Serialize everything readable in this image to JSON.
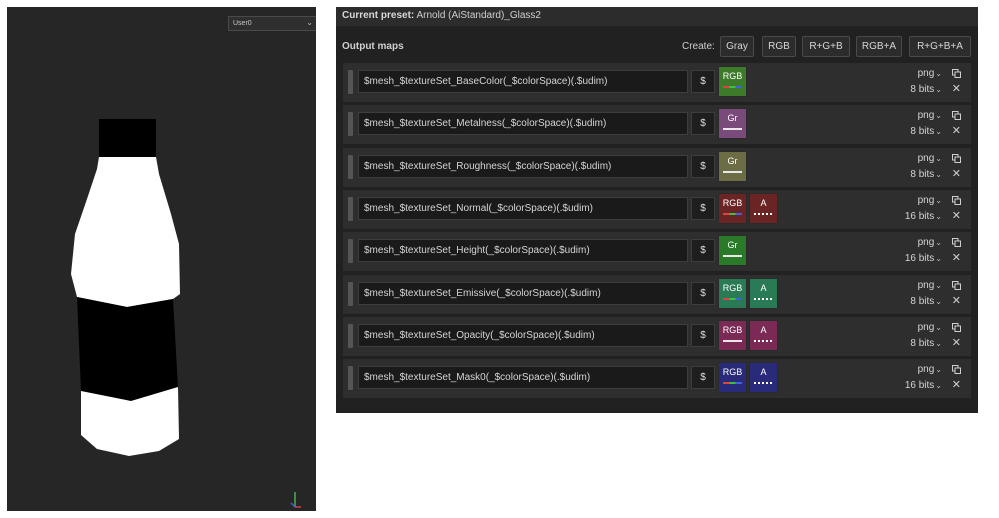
{
  "viewport": {
    "camera": "User0"
  },
  "preset": {
    "label": "Current preset:",
    "value": "Arnold (AiStandard)_Glass2"
  },
  "output_maps": {
    "title": "Output maps",
    "create_label": "Create:",
    "create_buttons": [
      "Gray",
      "RGB",
      "R+G+B",
      "RGB+A",
      "R+G+B+A"
    ]
  },
  "rows": [
    {
      "path": "$mesh_$textureSet_BaseColor(_$colorSpace)(.$udim)",
      "dollar": "$",
      "format": "png",
      "bits": "8 bits",
      "channels": [
        {
          "label": "RGB",
          "color": "#3d7a2a",
          "bar": "rgb"
        }
      ]
    },
    {
      "path": "$mesh_$textureSet_Metalness(_$colorSpace)(.$udim)",
      "dollar": "$",
      "format": "png",
      "bits": "8 bits",
      "channels": [
        {
          "label": "Gr",
          "color": "#7a4a7a",
          "bar": "solid"
        }
      ]
    },
    {
      "path": "$mesh_$textureSet_Roughness(_$colorSpace)(.$udim)",
      "dollar": "$",
      "format": "png",
      "bits": "8 bits",
      "channels": [
        {
          "label": "Gr",
          "color": "#6d6d45",
          "bar": "solid"
        }
      ]
    },
    {
      "path": "$mesh_$textureSet_Normal(_$colorSpace)(.$udim)",
      "dollar": "$",
      "format": "png",
      "bits": "16 bits",
      "channels": [
        {
          "label": "RGB",
          "color": "#6b2424",
          "bar": "rgb"
        },
        {
          "label": "A",
          "color": "#6b2424",
          "bar": "dotted"
        }
      ]
    },
    {
      "path": "$mesh_$textureSet_Height(_$colorSpace)(.$udim)",
      "dollar": "$",
      "format": "png",
      "bits": "16 bits",
      "channels": [
        {
          "label": "Gr",
          "color": "#2a7a2a",
          "bar": "solid"
        }
      ]
    },
    {
      "path": "$mesh_$textureSet_Emissive(_$colorSpace)(.$udim)",
      "dollar": "$",
      "format": "png",
      "bits": "8 bits",
      "channels": [
        {
          "label": "RGB",
          "color": "#2a7a55",
          "bar": "rgb"
        },
        {
          "label": "A",
          "color": "#2a7a55",
          "bar": "dotted"
        }
      ]
    },
    {
      "path": "$mesh_$textureSet_Opacity(_$colorSpace)(.$udim)",
      "dollar": "$",
      "format": "png",
      "bits": "8 bits",
      "channels": [
        {
          "label": "RGB",
          "color": "#7a2a55",
          "bar": "solid"
        },
        {
          "label": "A",
          "color": "#7a2a55",
          "bar": "dotted"
        }
      ]
    },
    {
      "path": "$mesh_$textureSet_Mask0(_$colorSpace)(.$udim)",
      "dollar": "$",
      "format": "png",
      "bits": "16 bits",
      "channels": [
        {
          "label": "RGB",
          "color": "#2a2a7a",
          "bar": "rgb"
        },
        {
          "label": "A",
          "color": "#2a2a7a",
          "bar": "dotted"
        }
      ]
    }
  ],
  "icons": {
    "copy": "copy-icon",
    "close": "close-icon",
    "dropdown": "chevron-down-icon",
    "axis": "axis-gizmo-icon"
  }
}
